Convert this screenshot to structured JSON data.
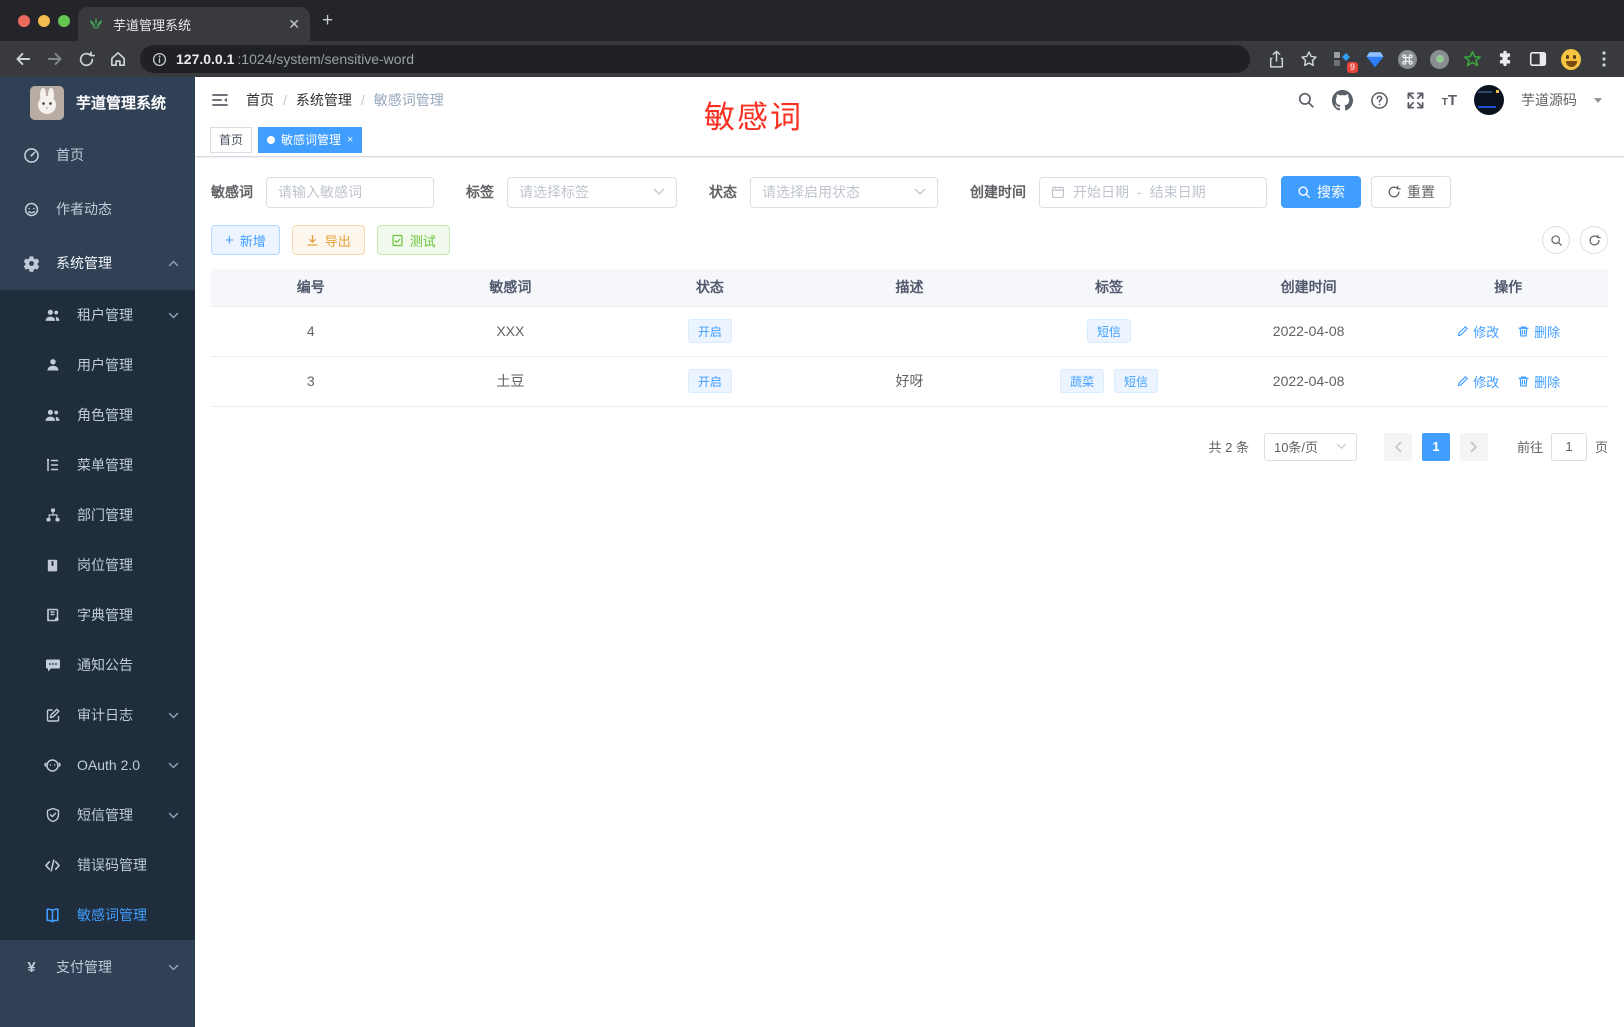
{
  "browser": {
    "tab_title": "芋道管理系统",
    "url_host": "127.0.0.1",
    "url_path": ":1024/system/sensitive-word",
    "extension_badge": "9"
  },
  "sidebar": {
    "title": "芋道管理系统",
    "items": [
      {
        "label": "首页"
      },
      {
        "label": "作者动态"
      },
      {
        "label": "系统管理"
      },
      {
        "label": "租户管理"
      },
      {
        "label": "用户管理"
      },
      {
        "label": "角色管理"
      },
      {
        "label": "菜单管理"
      },
      {
        "label": "部门管理"
      },
      {
        "label": "岗位管理"
      },
      {
        "label": "字典管理"
      },
      {
        "label": "通知公告"
      },
      {
        "label": "审计日志"
      },
      {
        "label": "OAuth 2.0"
      },
      {
        "label": "短信管理"
      },
      {
        "label": "错误码管理"
      },
      {
        "label": "敏感词管理"
      },
      {
        "label": "支付管理"
      }
    ]
  },
  "navbar": {
    "breadcrumb": {
      "home": "首页",
      "section": "系统管理",
      "current": "敏感词管理"
    },
    "separator": "/",
    "username": "芋道源码"
  },
  "annotation": {
    "text": "敏感词",
    "color": "#f92f21"
  },
  "tags_bar": {
    "home": "首页",
    "active": "敏感词管理",
    "close": "×"
  },
  "filters": {
    "keyword_label": "敏感词",
    "keyword_placeholder": "请输入敏感词",
    "tag_label": "标签",
    "tag_placeholder": "请选择标签",
    "status_label": "状态",
    "status_placeholder": "请选择启用状态",
    "date_label": "创建时间",
    "date_start_placeholder": "开始日期",
    "date_separator": "-",
    "date_end_placeholder": "结束日期",
    "search_label": "搜索",
    "reset_label": "重置"
  },
  "actions": {
    "add": "新增",
    "export": "导出",
    "test": "测试"
  },
  "table": {
    "headers": [
      "编号",
      "敏感词",
      "状态",
      "描述",
      "标签",
      "创建时间",
      "操作"
    ],
    "rows": [
      {
        "id": "4",
        "word": "XXX",
        "status": "开启",
        "description": "",
        "tags": [
          "短信"
        ],
        "created_at": "2022-04-08"
      },
      {
        "id": "3",
        "word": "土豆",
        "status": "开启",
        "description": "好呀",
        "tags": [
          "蔬菜",
          "短信"
        ],
        "created_at": "2022-04-08"
      }
    ],
    "edit_label": "修改",
    "delete_label": "删除"
  },
  "pagination": {
    "total": "共 2 条",
    "page_size": "10条/页",
    "page": "1",
    "goto_label": "前往",
    "goto_value": "1",
    "unit_label": "页"
  },
  "colors": {
    "accent": "#409eff",
    "sidebar_bg": "#304156",
    "submenu_bg": "#1f2d3d",
    "status_tag": "#409eff"
  }
}
